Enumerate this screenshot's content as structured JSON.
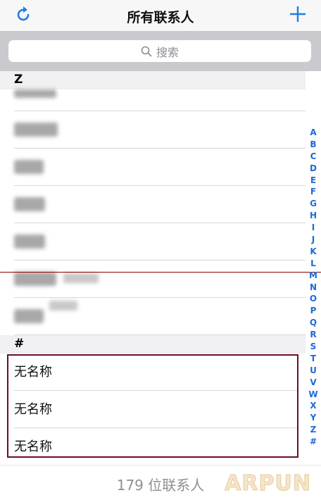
{
  "navbar": {
    "title": "所有联系人",
    "refresh_icon": "refresh-icon",
    "add_icon": "plus-icon",
    "accent_color": "#1e7fe0"
  },
  "search": {
    "placeholder": "搜索",
    "icon": "search-icon"
  },
  "sections": [
    {
      "header": "Z",
      "rows_blurred": 7
    },
    {
      "header": "#",
      "rows": [
        "无名称",
        "无名称",
        "无名称"
      ]
    }
  ],
  "index_letters": [
    "A",
    "B",
    "C",
    "D",
    "E",
    "F",
    "G",
    "H",
    "I",
    "J",
    "K",
    "L",
    "M",
    "N",
    "O",
    "P",
    "Q",
    "R",
    "S",
    "T",
    "U",
    "V",
    "W",
    "X",
    "Y",
    "Z",
    "#"
  ],
  "footer": {
    "count_text": "179 位联系人",
    "watermark": "ARPUN"
  }
}
